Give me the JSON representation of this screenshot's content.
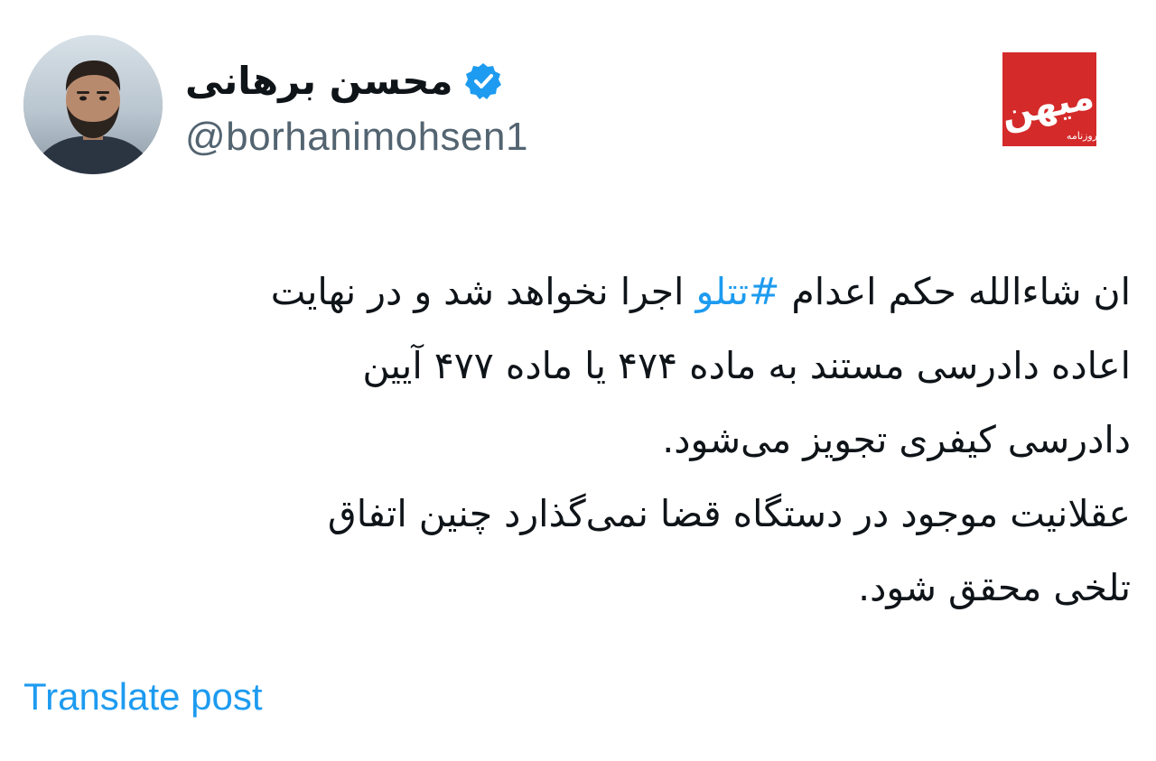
{
  "author": {
    "display_name": "محسن برهانی",
    "handle": "@borhanimohsen1",
    "verified": true,
    "avatar_icon": "profile-photo",
    "verified_icon": "verified-badge-icon"
  },
  "brand": {
    "logo_icon": "mehan-newspaper-logo",
    "logo_main_text": "میهن",
    "logo_small_text": "روزنامه",
    "color": "#d42a2a"
  },
  "post": {
    "line1": {
      "before": "ان شاءالله حکم اعدام ",
      "hashtag": "#تتلو",
      "after": " اجرا نخواهد شد و در نهایت"
    },
    "line2": "اعاده دادرسی مستند به ماده ۴۷۴ یا ماده ۴۷۷ آیین",
    "line3": "دادرسی کیفری تجویز می‌شود.",
    "line4": "عقلانیت موجود در دستگاه قضا نمی‌گذارد چنین اتفاق",
    "line5": "تلخی محقق شود."
  },
  "actions": {
    "translate_label": "Translate post"
  },
  "colors": {
    "link": "#1d9bf0",
    "text": "#0f1419",
    "secondary": "#536471"
  }
}
